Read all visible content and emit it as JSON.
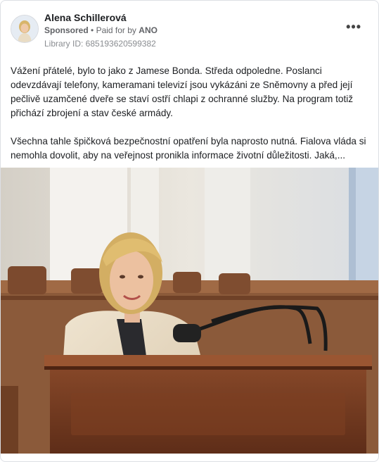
{
  "post": {
    "author": "Alena Schillerová",
    "sponsored": "Sponsored",
    "separator": "•",
    "paid_for_prefix": "Paid for by",
    "payer": "ANO",
    "library_id": "Library ID: 685193620599382",
    "more_label": "•••",
    "paragraphs": [
      "Vážení přátelé, bylo to jako z Jamese Bonda. Středa odpoledne. Poslanci odevzdávají telefony, kameramani televizí jsou vykázáni ze Sněmovny a před její pečlivě uzamčené dveře se staví ostří chlapi z ochranné služby. Na program totiž přichází zbrojení a stav české armády.",
      "Všechna tahle špičková bezpečnostní opatření byla naprosto nutná. Fialova vláda si nemohla dovolit, aby na veřejnost pronikla informace životní důležitosti. Jaká,..."
    ]
  },
  "colors": {
    "name": "#1c1e21",
    "meta": "#65676b",
    "border": "#dcdfe4"
  }
}
